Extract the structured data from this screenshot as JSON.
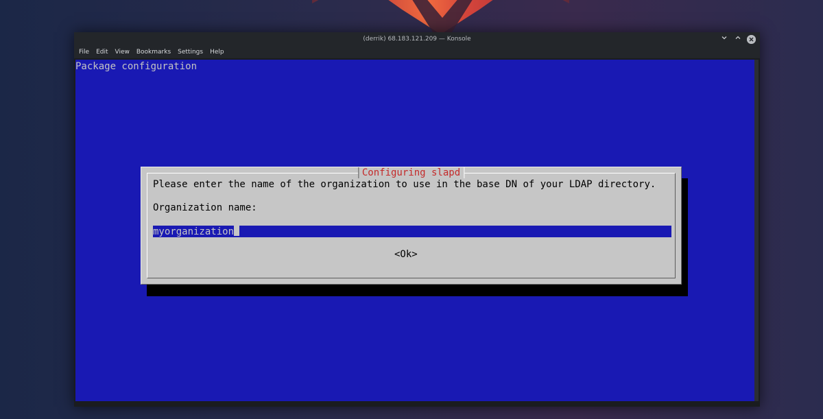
{
  "window": {
    "title": "(derrik) 68.183.121.209 — Konsole",
    "controls": {
      "minimize_icon": "chevron-down-icon",
      "maximize_icon": "chevron-up-icon",
      "close_icon": "close-icon"
    }
  },
  "menubar": {
    "items": [
      {
        "label": "File"
      },
      {
        "label": "Edit"
      },
      {
        "label": "View"
      },
      {
        "label": "Bookmarks"
      },
      {
        "label": "Settings"
      },
      {
        "label": "Help"
      }
    ]
  },
  "terminal": {
    "header": "Package configuration",
    "background": "#1919b3",
    "dialog": {
      "title": "Configuring slapd",
      "prompt": "Please enter the name of the organization to use in the base DN of your LDAP directory.",
      "field_label": "Organization name:",
      "field_value": "myorganization",
      "ok_label": "<Ok>",
      "title_color": "#c42a2a",
      "background": "#c6c6c6"
    }
  }
}
